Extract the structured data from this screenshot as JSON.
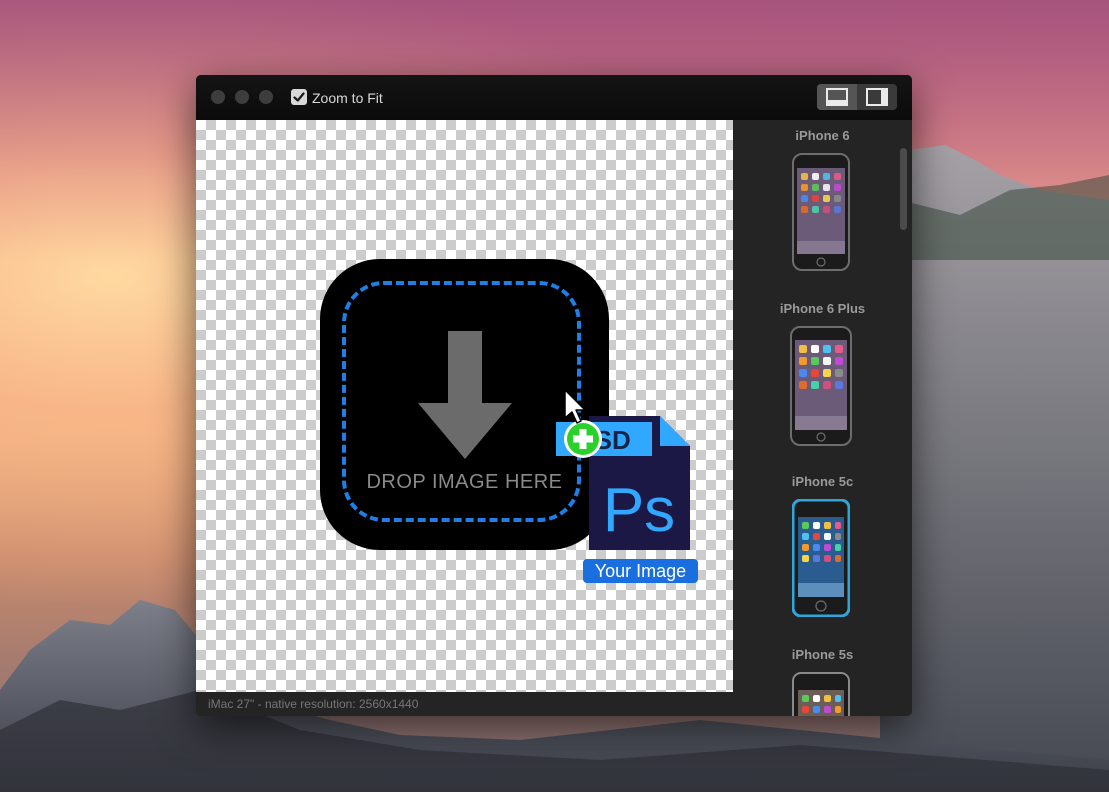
{
  "window": {
    "zoom_to_fit_label": "Zoom to Fit",
    "zoom_to_fit_checked": true
  },
  "canvas": {
    "drop_label": "DROP IMAGE HERE",
    "file_label": "Your Image",
    "file_type_badge": "PSD",
    "file_icon_text": "Ps"
  },
  "status": {
    "text": "iMac 27\" - native resolution: 2560x1440"
  },
  "sidebar": {
    "devices": [
      {
        "label": "iPhone 6"
      },
      {
        "label": "iPhone 6 Plus"
      },
      {
        "label": "iPhone 5c"
      },
      {
        "label": "iPhone 5s"
      }
    ]
  },
  "colors": {
    "accent": "#1f7fe5",
    "add_badge": "#2bd12b",
    "ps_blue": "#2fa3f0"
  }
}
